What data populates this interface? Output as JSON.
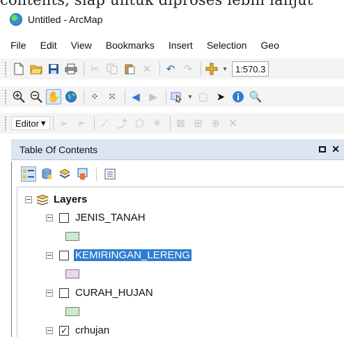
{
  "doc_snippet": "contents, siap untuk diproses lebih lanjut",
  "window": {
    "title": "Untitled - ArcMap"
  },
  "menubar": [
    "File",
    "Edit",
    "View",
    "Bookmarks",
    "Insert",
    "Selection",
    "Geo"
  ],
  "toolbar_standard": {
    "scale_value": "1:570.3"
  },
  "editor_toolbar": {
    "editor_label": "Editor",
    "editor_arrow": "▾"
  },
  "toc": {
    "title": "Table Of Contents",
    "close_glyph": "✕",
    "root_label": "Layers",
    "layers": [
      {
        "name": "JENIS_TANAH",
        "checked": false,
        "selected": false,
        "swatch_color": "#c8eccc"
      },
      {
        "name": "KEMIRINGAN_LERENG",
        "checked": false,
        "selected": true,
        "swatch_color": "#ead6f2"
      },
      {
        "name": "CURAH_HUJAN",
        "checked": false,
        "selected": false,
        "swatch_color": "#c8eccc"
      },
      {
        "name": "crhujan",
        "checked": true,
        "selected": false
      }
    ],
    "checked_mark": "✓"
  },
  "colors": {
    "selection_blue": "#2f7dd1",
    "toc_header_bg": "#dbe6f2"
  }
}
